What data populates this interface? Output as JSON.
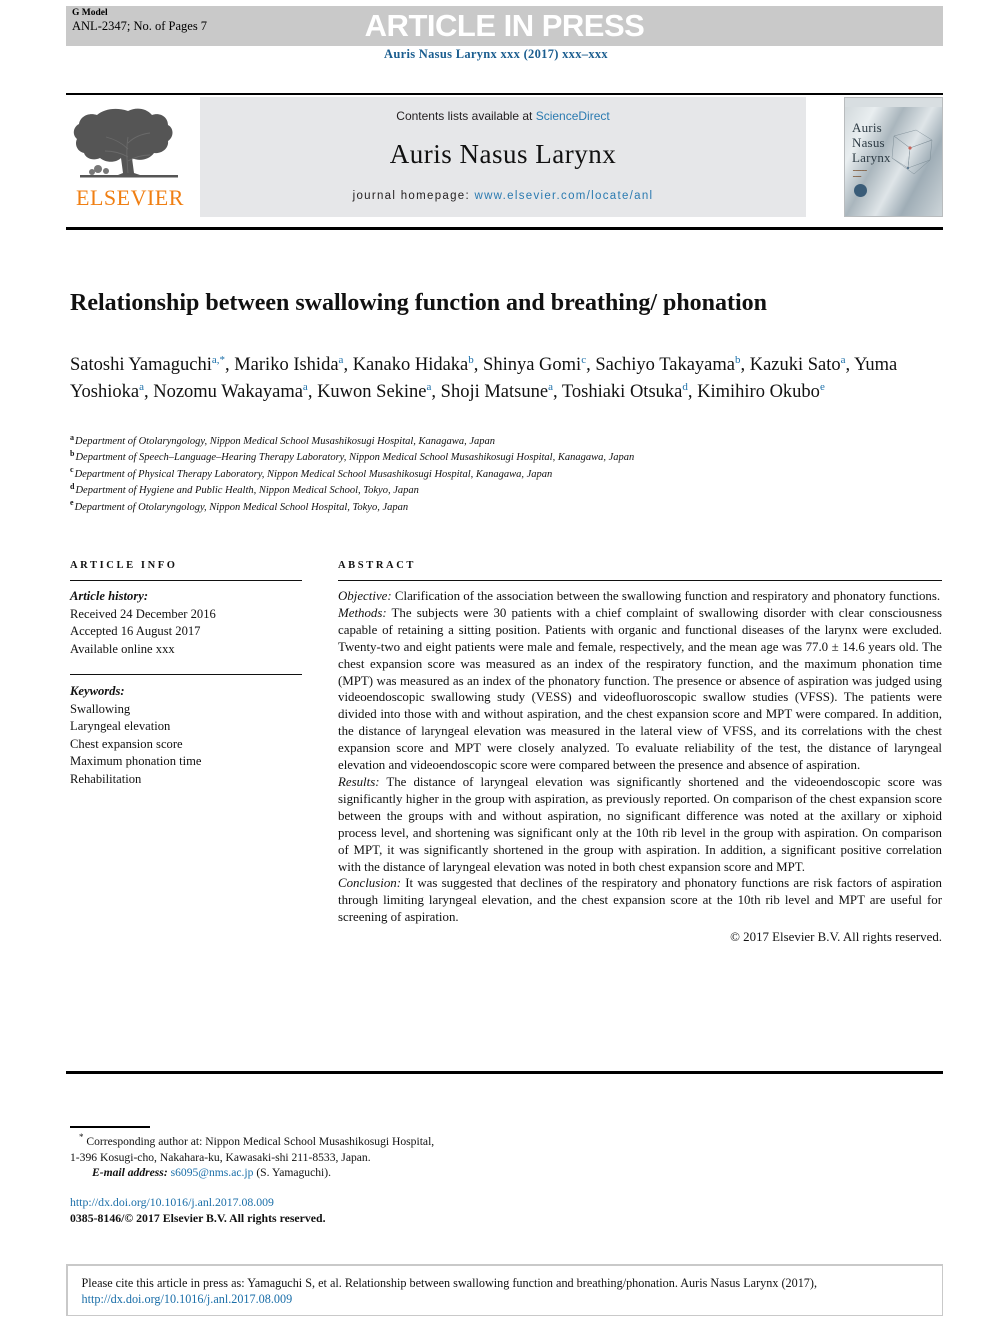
{
  "header": {
    "g_model_label": "G Model",
    "manuscript_id": "ANL-2347; No. of Pages 7",
    "press_banner": "ARTICLE IN PRESS",
    "journal_reference": "Auris Nasus Larynx xxx (2017) xxx–xxx"
  },
  "masthead": {
    "contents_prefix": "Contents lists available at ",
    "sciencedirect": "ScienceDirect",
    "journal_title": "Auris Nasus Larynx",
    "homepage_label": "journal homepage: ",
    "homepage_url": "www.elsevier.com/locate/anl",
    "publisher": "ELSEVIER",
    "publisher_logo": "elsevier-tree-logo",
    "cover_title_line1": "Auris",
    "cover_title_line2": "Nasus",
    "cover_title_line3": "Larynx"
  },
  "article": {
    "title": "Relationship between swallowing function and breathing/ phonation",
    "authors_html": "Satoshi Yamaguchi<sup class=\"star\">a,</sup><sup class=\"star\">*</sup>, Mariko Ishida<sup>a</sup>, Kanako Hidaka<sup>b</sup>, Shinya Gomi<sup>c</sup>, Sachiyo Takayama<sup>b</sup>, Kazuki Sato<sup>a</sup>, Yuma Yoshioka<sup>a</sup>, Nozomu Wakayama<sup>a</sup>, Kuwon Sekine<sup>a</sup>, Shoji Matsune<sup>a</sup>, Toshiaki Otsuka<sup>d</sup>, Kimihiro Okubo<sup>e</sup>",
    "affiliations": [
      {
        "mark": "a",
        "text": "Department of Otolaryngology, Nippon Medical School Musashikosugi Hospital, Kanagawa, Japan"
      },
      {
        "mark": "b",
        "text": "Department of Speech–Language–Hearing Therapy Laboratory, Nippon Medical School Musashikosugi Hospital, Kanagawa, Japan"
      },
      {
        "mark": "c",
        "text": "Department of Physical Therapy Laboratory, Nippon Medical School Musashikosugi Hospital, Kanagawa, Japan"
      },
      {
        "mark": "d",
        "text": "Department of Hygiene and Public Health, Nippon Medical School, Tokyo, Japan"
      },
      {
        "mark": "e",
        "text": "Department of Otolaryngology, Nippon Medical School Hospital, Tokyo, Japan"
      }
    ]
  },
  "article_info": {
    "heading": "ARTICLE INFO",
    "history_label": "Article history:",
    "history": [
      "Received 24 December 2016",
      "Accepted 16 August 2017",
      "Available online xxx"
    ],
    "keywords_label": "Keywords:",
    "keywords": [
      "Swallowing",
      "Laryngeal elevation",
      "Chest expansion score",
      "Maximum phonation time",
      "Rehabilitation"
    ]
  },
  "abstract": {
    "heading": "ABSTRACT",
    "sections": [
      {
        "label": "Objective:",
        "text": " Clarification of the association between the swallowing function and respiratory and phonatory functions."
      },
      {
        "label": "Methods:",
        "text": " The subjects were 30 patients with a chief complaint of swallowing disorder with clear consciousness capable of retaining a sitting position. Patients with organic and functional diseases of the larynx were excluded. Twenty-two and eight patients were male and female, respectively, and the mean age was 77.0 ± 14.6 years old. The chest expansion score was measured as an index of the respiratory function, and the maximum phonation time (MPT) was measured as an index of the phonatory function. The presence or absence of aspiration was judged using videoendoscopic swallowing study (VESS) and videofluoroscopic swallow studies (VFSS). The patients were divided into those with and without aspiration, and the chest expansion score and MPT were compared. In addition, the distance of laryngeal elevation was measured in the lateral view of VFSS, and its correlations with the chest expansion score and MPT were closely analyzed. To evaluate reliability of the test, the distance of laryngeal elevation and videoendoscopic score were compared between the presence and absence of aspiration."
      },
      {
        "label": "Results:",
        "text": " The distance of laryngeal elevation was significantly shortened and the videoendoscopic score was significantly higher in the group with aspiration, as previously reported. On comparison of the chest expansion score between the groups with and without aspiration, no significant difference was noted at the axillary or xiphoid process level, and shortening was significant only at the 10th rib level in the group with aspiration. On comparison of MPT, it was significantly shortened in the group with aspiration. In addition, a significant positive correlation with the distance of laryngeal elevation was noted in both chest expansion score and MPT."
      },
      {
        "label": "Conclusion:",
        "text": " It was suggested that declines of the respiratory and phonatory functions are risk factors of aspiration through limiting laryngeal elevation, and the chest expansion score at the 10th rib level and MPT are useful for screening of aspiration."
      }
    ],
    "copyright": "© 2017 Elsevier B.V. All rights reserved."
  },
  "footnotes": {
    "corresponding_line1": "Corresponding author at: Nippon Medical School Musashikosugi Hospital,",
    "corresponding_line2": "1-396 Kosugi-cho, Nakahara-ku, Kawasaki-shi 211-8533, Japan.",
    "email_label": "E-mail address:",
    "email": "s6095@nms.ac.jp",
    "email_owner": "(S. Yamaguchi).",
    "doi_url": "http://dx.doi.org/10.1016/j.anl.2017.08.009",
    "issn_line": "0385-8146/© 2017 Elsevier B.V. All rights reserved."
  },
  "cite_box": {
    "text": "Please cite this article in press as: Yamaguchi S, et al. Relationship between swallowing function and breathing/phonation. Auris Nasus Larynx (2017), ",
    "link": "http://dx.doi.org/10.1016/j.anl.2017.08.009"
  },
  "colors": {
    "link": "#1a6ea8",
    "band": "#c9c9c9",
    "masthead_bg": "#e6e7e9",
    "elsevier_orange": "#f07f13"
  }
}
